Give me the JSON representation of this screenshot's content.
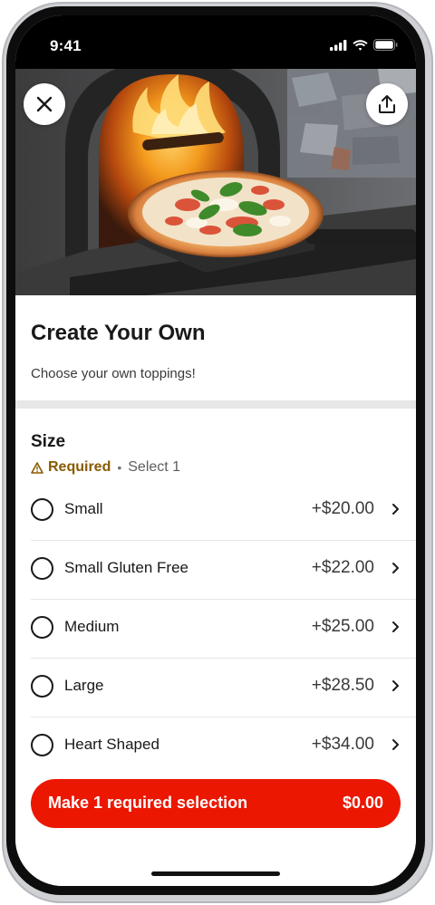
{
  "status_bar": {
    "time": "9:41"
  },
  "hero": {
    "image_alt": "Wood-fired pizza on a peel in front of an oven",
    "close_icon": "close-icon",
    "share_icon": "share-icon"
  },
  "item": {
    "title": "Create Your Own",
    "description": "Choose your own toppings!"
  },
  "size_section": {
    "heading": "Size",
    "required_label": "Required",
    "separator": "•",
    "select_hint": "Select 1",
    "options": [
      {
        "label": "Small",
        "price": "+$20.00"
      },
      {
        "label": "Small Gluten Free",
        "price": "+$22.00"
      },
      {
        "label": "Medium",
        "price": "+$25.00"
      },
      {
        "label": "Large",
        "price": "+$28.50"
      },
      {
        "label": "Heart Shaped",
        "price": "+$34.00"
      }
    ]
  },
  "cta": {
    "label": "Make 1 required selection",
    "price": "$0.00"
  },
  "colors": {
    "accent": "#eb1700",
    "required": "#8a5a00"
  }
}
